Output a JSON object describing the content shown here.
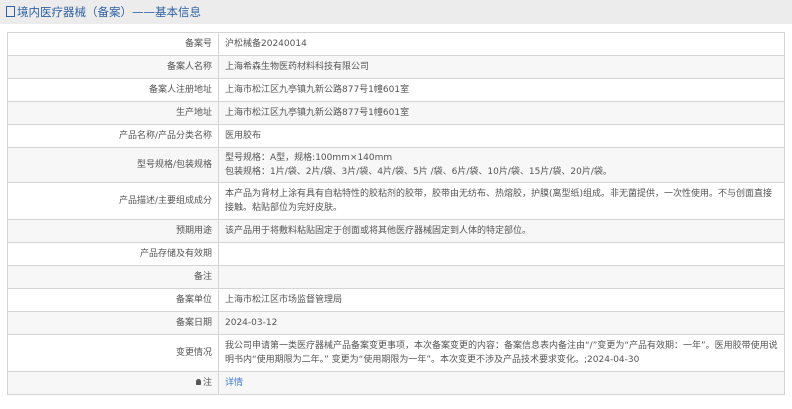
{
  "header": {
    "title": "境内医疗器械（备案）——基本信息"
  },
  "rows": [
    {
      "label": "备案号",
      "value": "沪松械备20240014"
    },
    {
      "label": "备案人名称",
      "value": "上海希森生物医药材料科技有限公司"
    },
    {
      "label": "备案人注册地址",
      "value": "上海市松江区九亭镇九新公路877号1幢601室"
    },
    {
      "label": "生产地址",
      "value": "上海市松江区九亭镇九新公路877号1幢601室"
    },
    {
      "label": "产品名称/产品分类名称",
      "value": "医用胶布"
    },
    {
      "label": "型号规格/包装规格",
      "value": "型号规格：A型，规格:100mm×140mm",
      "value2": "包装规格：1片/袋、2片/袋、3片/袋、4片/袋、5片 /袋、6片/袋、10片/袋、15片/袋、20片/袋。"
    },
    {
      "label": "产品描述/主要组成成分",
      "value": "本产品为背材上涂有具有自粘特性的胶粘剂的胶带，胶带由无纺布、热熔胶，护膜(离型纸)组成。非无菌提供，一次性使用。不与创面直接接触。粘贴部位为完好皮肤。"
    },
    {
      "label": "预期用途",
      "value": "该产品用于将敷料粘贴固定于创面或将其他医疗器械固定到人体的特定部位。"
    },
    {
      "label": "产品存储及有效期",
      "value": ""
    },
    {
      "label": "备注",
      "value": ""
    },
    {
      "label": "备案单位",
      "value": "上海市松江区市场监督管理局"
    },
    {
      "label": "备案日期",
      "value": "2024-03-12"
    },
    {
      "label": "变更情况",
      "value": "我公司申请第一类医疗器械产品备案变更事项，本次备案变更的内容：备案信息表内备注由“/”变更为“产品有效期：一年”。医用胶带使用说明书内“使用期限为二年。” 变更为“使用期限为一年”。本次变更不涉及产品技术要求变化。;2024-04-30"
    },
    {
      "label": "注",
      "value": "详情"
    }
  ]
}
